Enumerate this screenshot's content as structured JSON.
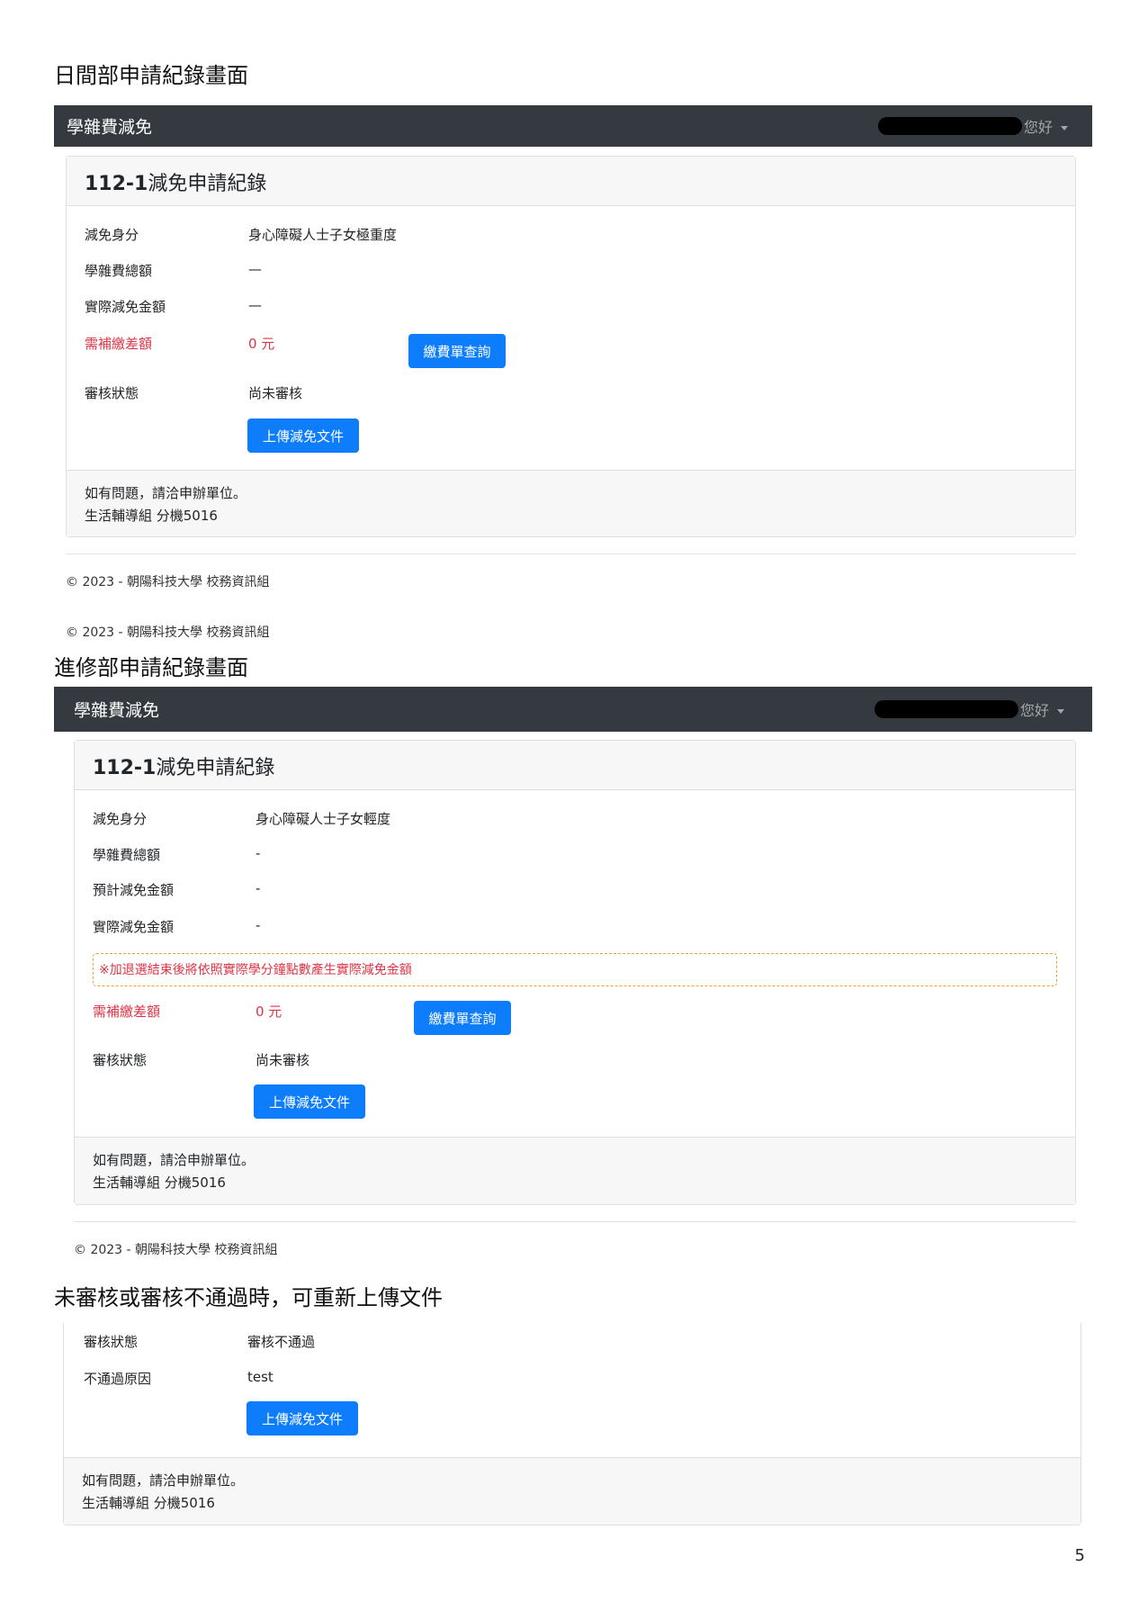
{
  "section1": {
    "heading": "日間部申請紀錄畫面",
    "navbar": {
      "brand": "學雜費減免",
      "greeting": "您好"
    },
    "card": {
      "title_bold": "112-1",
      "title_rest": "減免申請紀錄",
      "rows": [
        {
          "label": "減免身分",
          "value": "身心障礙人士子女極重度"
        },
        {
          "label": "學雜費總額",
          "value": "—"
        },
        {
          "label": "實際減免金額",
          "value": "—"
        }
      ],
      "diff_label": "需補繳差額",
      "diff_value": "0 元",
      "bill_button": "繳費單查詢",
      "status_label": "審核狀態",
      "status_value": "尚未審核",
      "upload_button": "上傳減免文件",
      "footer_line1": "如有問題，請洽申辦單位。",
      "footer_line2": "生活輔導組 分機5016"
    },
    "copyright1": "© 2023 - 朝陽科技大學 校務資訊組",
    "copyright2": "© 2023 - 朝陽科技大學 校務資訊組"
  },
  "section2": {
    "heading": "進修部申請紀錄畫面",
    "navbar": {
      "brand": "學雜費減免",
      "greeting": "您好"
    },
    "card": {
      "title_bold": "112-1",
      "title_rest": "減免申請紀錄",
      "rows": [
        {
          "label": "減免身分",
          "value": "身心障礙人士子女輕度"
        },
        {
          "label": "學雜費總額",
          "value": "-"
        },
        {
          "label": "預計減免金額",
          "value": "-"
        },
        {
          "label": "實際減免金額",
          "value": "-"
        }
      ],
      "notice": "※加退選結束後將依照實際學分鐘點數產生實際減免金額",
      "diff_label": "需補繳差額",
      "diff_value": "0 元",
      "bill_button": "繳費單查詢",
      "status_label": "審核狀態",
      "status_value": "尚未審核",
      "upload_button": "上傳減免文件",
      "footer_line1": "如有問題，請洽申辦單位。",
      "footer_line2": "生活輔導組 分機5016"
    },
    "copyright": "© 2023 - 朝陽科技大學 校務資訊組"
  },
  "section3": {
    "heading": "未審核或審核不通過時，可重新上傳文件",
    "card": {
      "status_label": "審核狀態",
      "status_value": "審核不通過",
      "reason_label": "不通過原因",
      "reason_value": "test",
      "upload_button": "上傳減免文件",
      "footer_line1": "如有問題，請洽申辦單位。",
      "footer_line2": "生活輔導組 分機5016"
    }
  },
  "page_number": "5",
  "colors": {
    "navbar": "#343a40",
    "primary_button": "#0d7dfb",
    "danger_text": "#dc3545",
    "notice_border": "#f0a030"
  }
}
